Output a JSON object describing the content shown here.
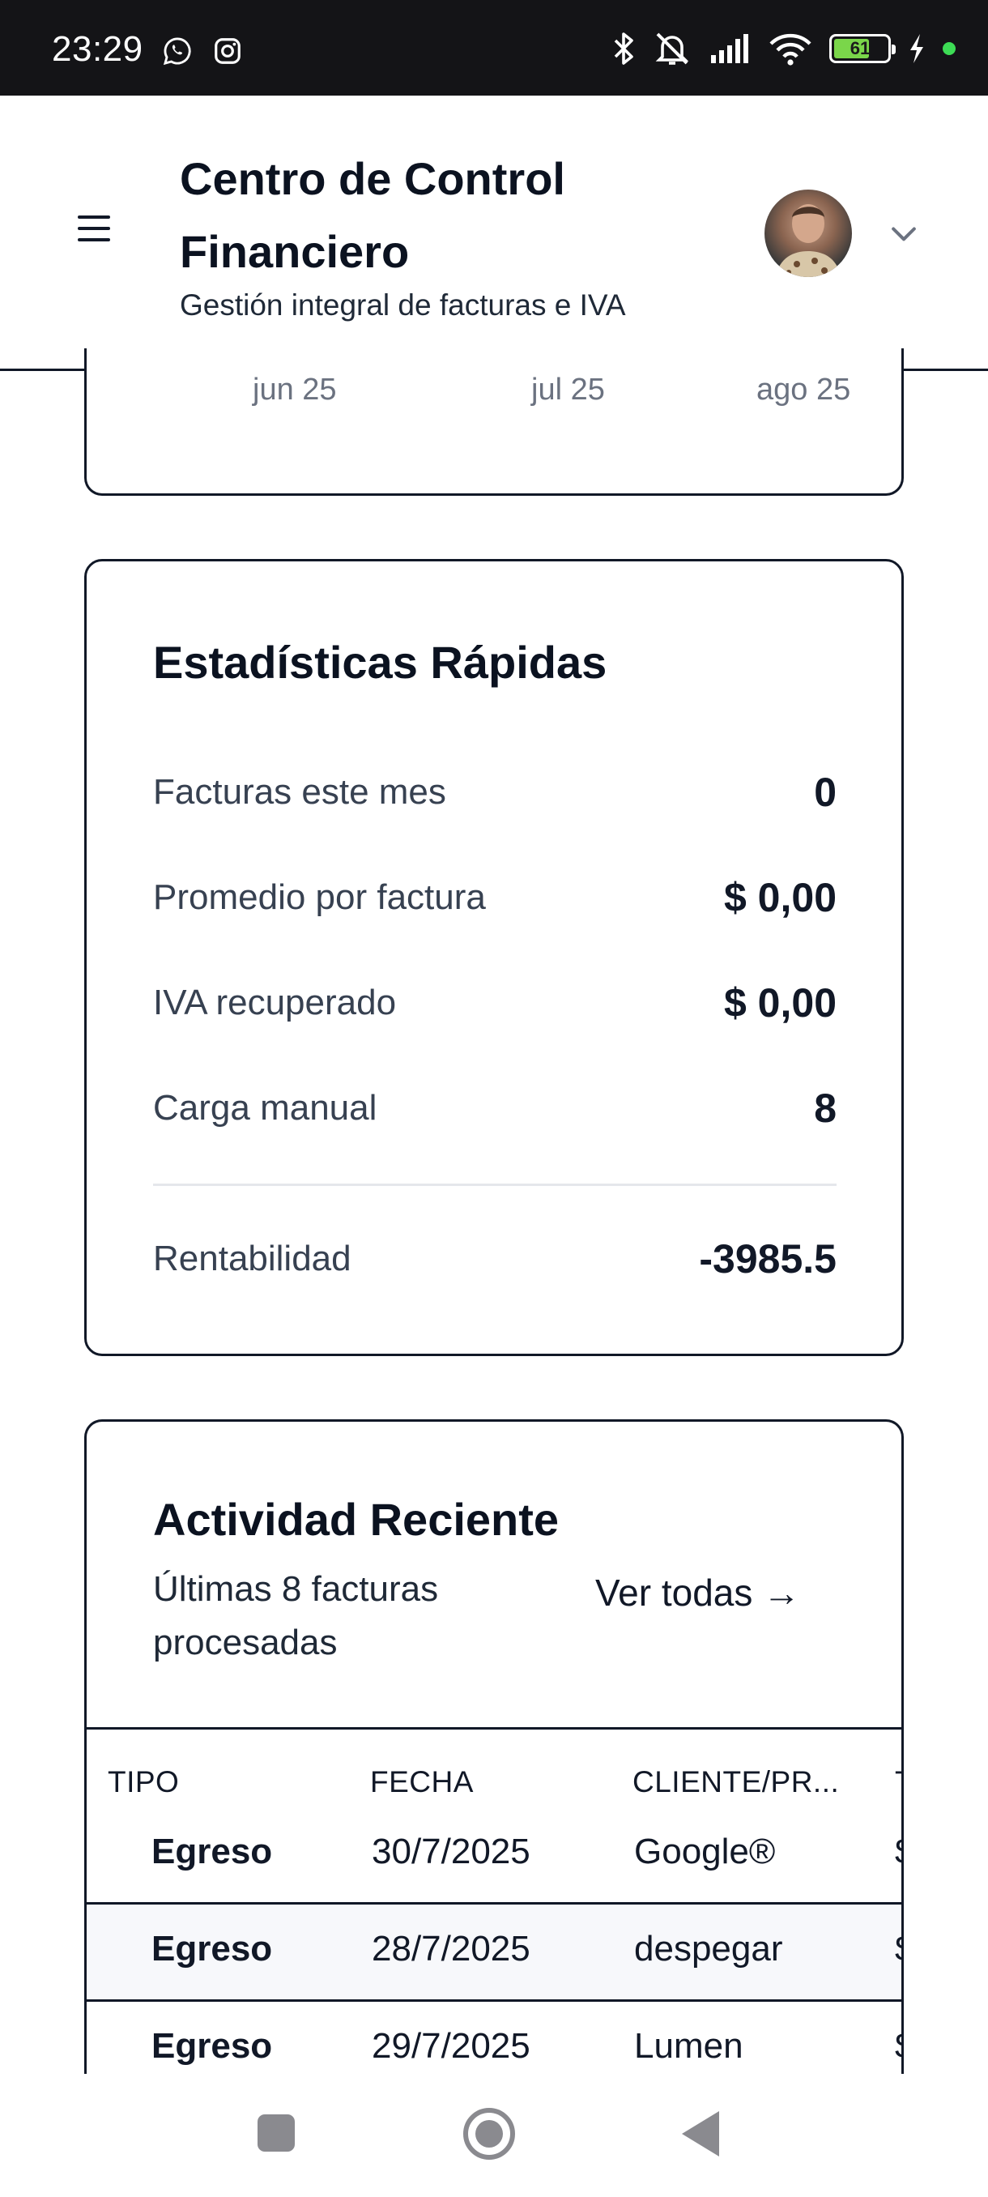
{
  "status_bar": {
    "time": "23:29",
    "battery": "61",
    "icons": [
      "whatsapp-icon",
      "instagram-icon",
      "bluetooth-icon",
      "silent-icon",
      "signal-icon",
      "wifi-icon",
      "battery-icon",
      "charging-icon"
    ]
  },
  "header": {
    "title": "Centro de Control Financiero",
    "subtitle": "Gestión integral de facturas e IVA"
  },
  "chart_tail": {
    "x_ticks": [
      "jun 25",
      "jul 25",
      "ago 25"
    ]
  },
  "quick_stats": {
    "title": "Estadísticas Rápidas",
    "rows": [
      {
        "label": "Facturas este mes",
        "value": "0"
      },
      {
        "label": "Promedio por factura",
        "value": "$ 0,00"
      },
      {
        "label": "IVA recuperado",
        "value": "$ 0,00"
      },
      {
        "label": "Carga manual",
        "value": "8"
      }
    ],
    "profitability": {
      "label": "Rentabilidad",
      "value": "-3985.5"
    }
  },
  "recent_activity": {
    "title": "Actividad Reciente",
    "subtitle": "Últimas 8 facturas procesadas",
    "view_all": "Ver todas →",
    "columns": [
      "TIPO",
      "FECHA",
      "CLIENTE/PR...",
      "T"
    ],
    "rows": [
      {
        "type": "Egreso",
        "date": "30/7/2025",
        "client": "Google®",
        "cut": "$"
      },
      {
        "type": "Egreso",
        "date": "28/7/2025",
        "client": "despegar",
        "cut": "$"
      },
      {
        "type": "Egreso",
        "date": "29/7/2025",
        "client": "Lumen",
        "cut": "$"
      }
    ]
  },
  "colors": {
    "status_bar": "#141417",
    "text_primary": "#111827",
    "text_secondary": "#374151",
    "border": "#111827",
    "row_alt": "#f7f8fb",
    "battery_fill": "#7ad64a"
  }
}
